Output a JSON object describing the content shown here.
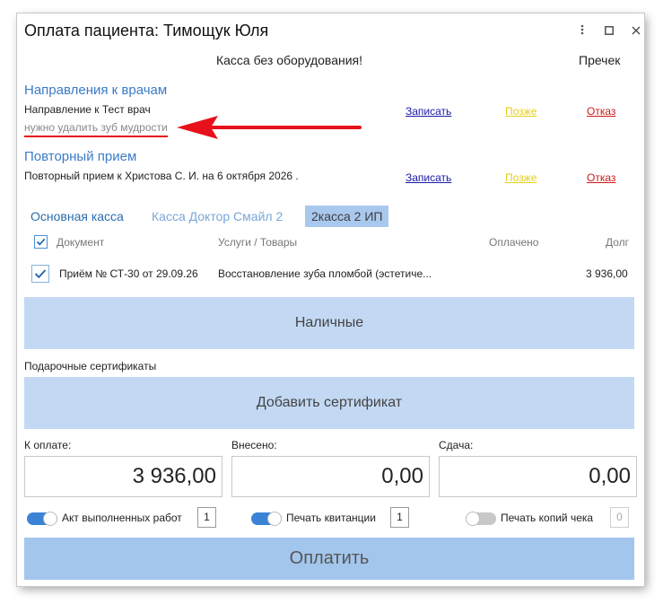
{
  "window": {
    "title": "Оплата пациента: Тимощук Юля",
    "menu_icon": "kebab-menu-icon",
    "maximize_icon": "maximize-icon",
    "close_icon": "close-icon"
  },
  "notice": "Касса без оборудования!",
  "precheck": "Пречек",
  "referrals": {
    "title": "Направления к врачам",
    "subtitle": "Направление к Тест врач",
    "comment": "нужно удалить зуб мудрости",
    "actions": {
      "book": "Записать",
      "later": "Позже",
      "refuse": "Отказ"
    }
  },
  "repeat": {
    "title": "Повторный прием",
    "subtitle": "Повторный прием к Христова С. И. на 6 октября 2026 .",
    "actions": {
      "book": "Записать",
      "later": "Позже",
      "refuse": "Отказ"
    }
  },
  "tabs": [
    {
      "label": "Основная касса"
    },
    {
      "label": "Касса Доктор Смайл 2"
    },
    {
      "label": "2касса 2 ИП",
      "active": true
    }
  ],
  "table": {
    "headers": {
      "document": "Документ",
      "services": "Услуги / Товары",
      "paid": "Оплачено",
      "debt": "Долг"
    },
    "rows": [
      {
        "checked": true,
        "document": "Приём № СТ-30 от 29.09.26",
        "services": "Восстановление зуба пломбой (эстетиче...",
        "paid": "",
        "debt": "3 936,00"
      }
    ]
  },
  "cash_button": "Наличные",
  "gift": {
    "label": "Подарочные сертификаты",
    "add_button": "Добавить сертификат"
  },
  "totals": {
    "to_pay_label": "К оплате:",
    "to_pay": "3 936,00",
    "deposited_label": "Внесено:",
    "deposited": "0,00",
    "change_label": "Сдача:",
    "change": "0,00"
  },
  "print_options": [
    {
      "label": "Акт выполненных работ",
      "enabled": true,
      "count": "1"
    },
    {
      "label": "Печать квитанции",
      "enabled": true,
      "count": "1"
    },
    {
      "label": "Печать копий чека",
      "enabled": false,
      "count": "0"
    }
  ],
  "pay_button": "Оплатить",
  "colors": {
    "accent": "#3a7bc8",
    "button_bg": "#c3d9f3",
    "pay_bg": "#a3c6ec",
    "annotation_red": "#e8101a",
    "link_yellow": "#e2cf1a",
    "link_red": "#cc1a1a"
  }
}
